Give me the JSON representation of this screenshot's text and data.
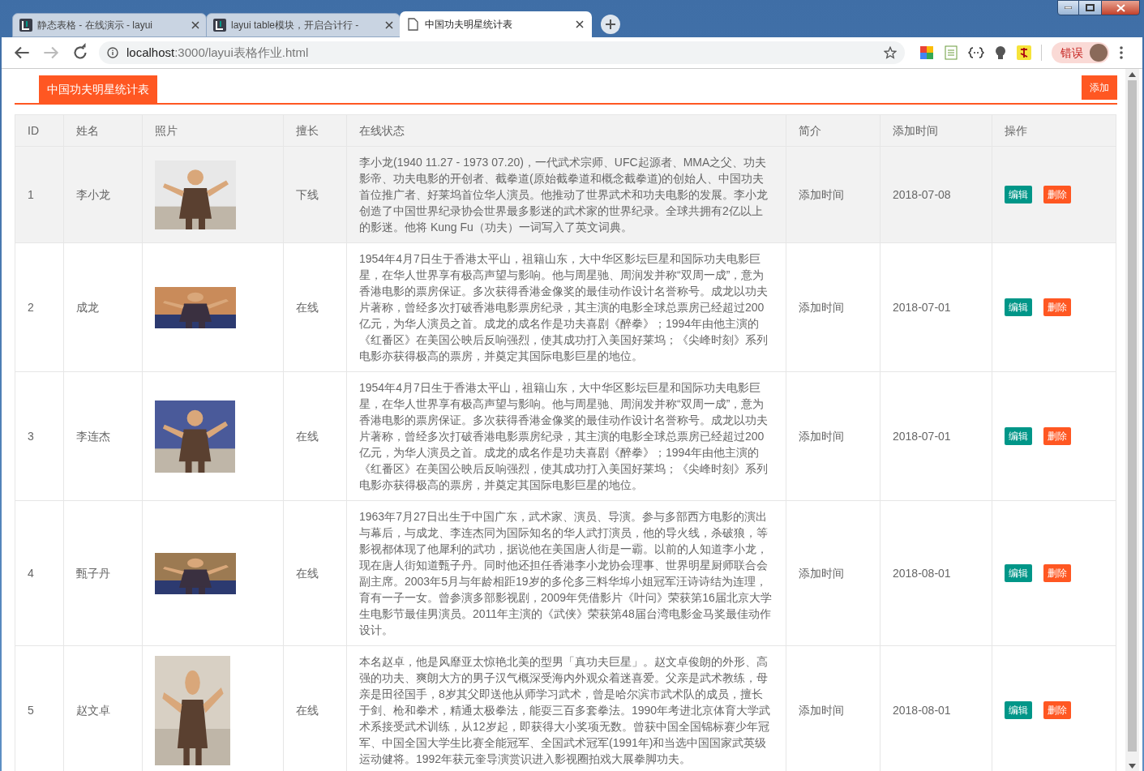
{
  "browser": {
    "tabs": [
      {
        "title": "静态表格 - 在线演示 - layui",
        "kind": "layui",
        "selected": false
      },
      {
        "title": "layui table模块，开启合计行 -",
        "kind": "layui",
        "selected": false
      },
      {
        "title": "中国功夫明星统计表",
        "kind": "page",
        "selected": true
      }
    ],
    "address": {
      "host": "localhost",
      "path": ":3000/layui表格作业.html"
    },
    "profile_label": "错误"
  },
  "page": {
    "title_tab": "中国功夫明星统计表",
    "add_button": "添加",
    "table": {
      "columns": [
        "ID",
        "姓名",
        "照片",
        "擅长",
        "在线状态",
        "简介",
        "添加时间",
        "操作"
      ],
      "rows": [
        {
          "hovered": true,
          "id": "1",
          "name": "李小龙",
          "photo": {
            "kind": "picture"
          },
          "column_4": "下线",
          "column_5": "李小龙(1940 11.27 - 1973 07.20)，一代武术宗师、UFC起源者、MMA之父、功夫影帝、功夫电影的开创者、截拳道(原始截拳道和概念截拳道)的创始人、中国功夫首位推广者、好莱坞首位华人演员。他推动了世界武术和功夫电影的发展。李小龙创造了中国世界纪录协会世界最多影迷的武术家的世界纪录。全球共拥有2亿以上的影迷。他将 Kung Fu（功夫）一词写入了英文词典。",
          "column_6": "添加时间",
          "column_7": "2018-07-08",
          "actions": [
            "编辑",
            "删除"
          ]
        },
        {
          "hovered": false,
          "id": "2",
          "name": "成龙",
          "photo": {
            "kind": "picture"
          },
          "column_4": "在线",
          "column_5": "1954年4月7日生于香港太平山，祖籍山东，大中华区影坛巨星和国际功夫电影巨星，在华人世界享有极高声望与影响。他与周星驰、周润发并称“双周一成”，意为香港电影的票房保证。多次获得香港金像奖的最佳动作设计名誉称号。成龙以功夫片著称，曾经多次打破香港电影票房纪录，其主演的电影全球总票房已经超过200亿元，为华人演员之首。成龙的成名作是功夫喜剧《醉拳》；1994年由他主演的《红番区》在美国公映后反响强烈，使其成功打入美国好莱坞；《尖峰时刻》系列电影亦获得极高的票房，并奠定其国际电影巨星的地位。",
          "column_6": "添加时间",
          "column_7": "2018-07-01",
          "actions": [
            "编辑",
            "删除"
          ]
        },
        {
          "hovered": false,
          "id": "3",
          "name": "李连杰",
          "photo": {
            "kind": "picture"
          },
          "column_4": "在线",
          "column_5": "1954年4月7日生于香港太平山，祖籍山东，大中华区影坛巨星和国际功夫电影巨星，在华人世界享有极高声望与影响。他与周星驰、周润发并称“双周一成”，意为香港电影的票房保证。多次获得香港金像奖的最佳动作设计名誉称号。成龙以功夫片著称，曾经多次打破香港电影票房纪录，其主演的电影全球总票房已经超过200亿元，为华人演员之首。成龙的成名作是功夫喜剧《醉拳》；1994年由他主演的《红番区》在美国公映后反响强烈，使其成功打入美国好莱坞；《尖峰时刻》系列电影亦获得极高的票房，并奠定其国际电影巨星的地位。",
          "column_6": "添加时间",
          "column_7": "2018-07-01",
          "actions": [
            "编辑",
            "删除"
          ]
        },
        {
          "hovered": false,
          "id": "4",
          "name": "甄子丹",
          "photo": {
            "kind": "picture"
          },
          "column_4": "在线",
          "column_5": "1963年7月27日出生于中国广东，武术家、演员、导演。参与多部西方电影的演出与幕后，与成龙、李连杰同为国际知名的华人武打演员，他的导火线，杀破狼，等影视都体现了他犀利的武功，据说他在美国唐人街是一霸。以前的人知道李小龙，现在唐人街知道甄子丹。同时他还担任香港李小龙协会理事、世界明星厨师联合会副主席。2003年5月与年龄相距19岁的多伦多三料华埠小姐冠军汪诗诗结为连理，育有一子一女。曾参演多部影视剧，2009年凭借影片《叶问》荣获第16届北京大学生电影节最佳男演员。2011年主演的《武侠》荣获第48届台湾电影金马奖最佳动作设计。",
          "column_6": "添加时间",
          "column_7": "2018-08-01",
          "actions": [
            "编辑",
            "删除"
          ]
        },
        {
          "hovered": false,
          "id": "5",
          "name": "赵文卓",
          "photo": {
            "kind": "picture"
          },
          "column_4": "在线",
          "column_5": "本名赵卓，他是风靡亚太惊艳北美的型男「真功夫巨星」。赵文卓俊朗的外形、高强的功夫、爽朗大方的男子汉气概深受海内外观众着迷喜爱。父亲是武术教练，母亲是田径国手，8岁其父即送他从师学习武术，曾是哈尔滨市武术队的成员，擅长于剑、枪和拳术，精通太极拳法，能耍三百多套拳法。1990年考进北京体育大学武术系接受武术训练，从12岁起，即获得大小奖项无数。曾获中国全国锦标赛少年冠军、中国全国大学生比赛全能冠军、全国武术冠军(1991年)和当选中国国家武英级运动健将。1992年获元奎导演赏识进入影视圈拍戏大展拳脚功夫。",
          "column_6": "添加时间",
          "column_7": "2018-08-01",
          "actions": [
            "编辑",
            "删除"
          ]
        }
      ]
    }
  }
}
